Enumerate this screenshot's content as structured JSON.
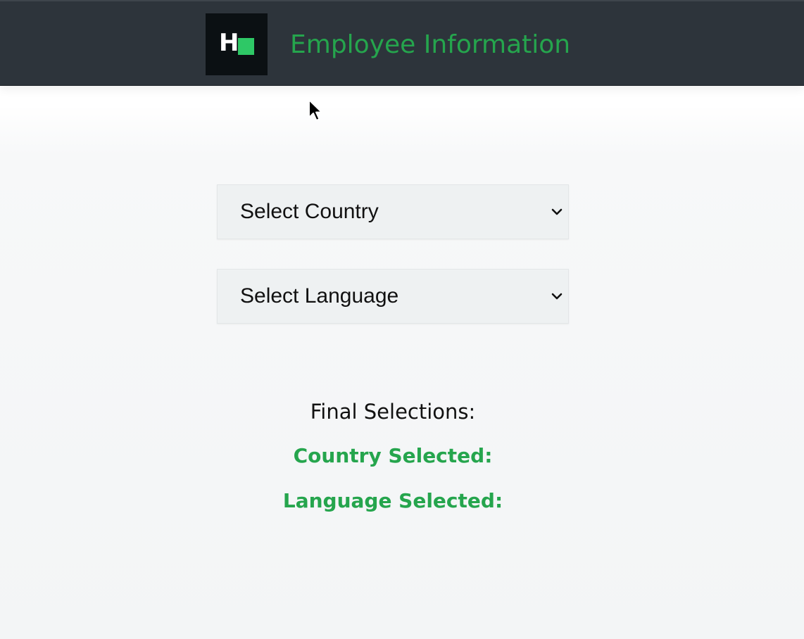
{
  "header": {
    "logo_letter": "H",
    "title": "Employee Information"
  },
  "form": {
    "country_select": {
      "label": "Select Country"
    },
    "language_select": {
      "label": "Select Language"
    }
  },
  "results": {
    "heading": "Final Selections:",
    "country_label": "Country Selected:",
    "language_label": "Language Selected:"
  },
  "colors": {
    "header_bg": "#2d343b",
    "accent_green": "#25a54d",
    "logo_bg": "#0b1013"
  },
  "icons": {
    "dropdown": "chevron-down-icon",
    "cursor": "mouse-pointer-icon"
  }
}
